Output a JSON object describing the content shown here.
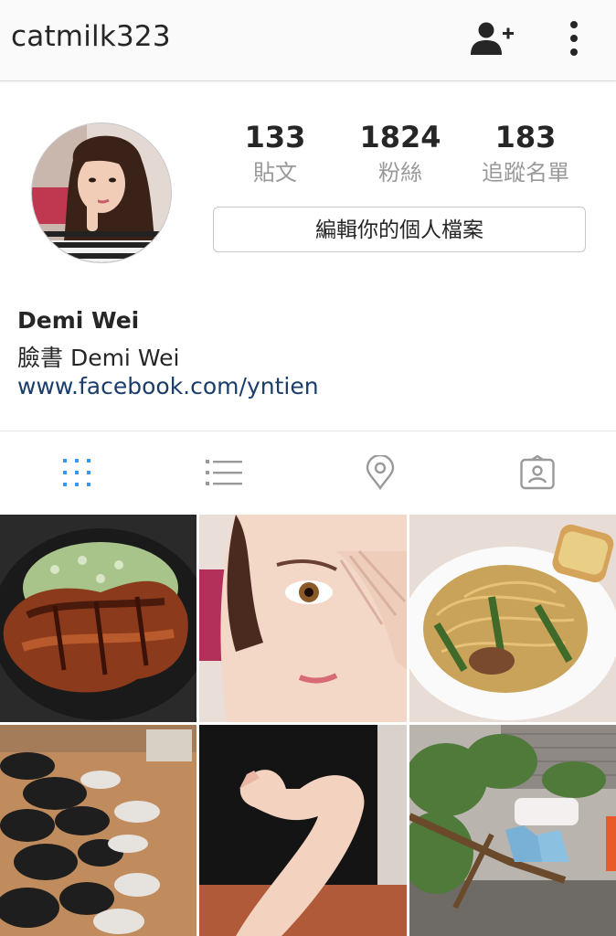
{
  "header": {
    "username": "catmilk323",
    "add_icon": "add-user-icon",
    "more_icon": "more-vertical-icon"
  },
  "profile": {
    "stats": [
      {
        "value": "133",
        "label": "貼文"
      },
      {
        "value": "1824",
        "label": "粉絲"
      },
      {
        "value": "183",
        "label": "追蹤名單"
      }
    ],
    "edit_label": "編輯你的個人檔案",
    "full_name": "Demi Wei",
    "bio": "臉書 Demi Wei",
    "link": "www.facebook.com/yntien"
  },
  "tabs": [
    {
      "icon": "grid-view-icon",
      "active": true
    },
    {
      "icon": "list-view-icon",
      "active": false
    },
    {
      "icon": "location-pin-icon",
      "active": false
    },
    {
      "icon": "tagged-photos-icon",
      "active": false
    }
  ],
  "colors": {
    "active_tab": "#3897f0",
    "inactive_tab": "#999999",
    "link": "#1a3d6b",
    "text": "#262626",
    "muted": "#999999"
  }
}
